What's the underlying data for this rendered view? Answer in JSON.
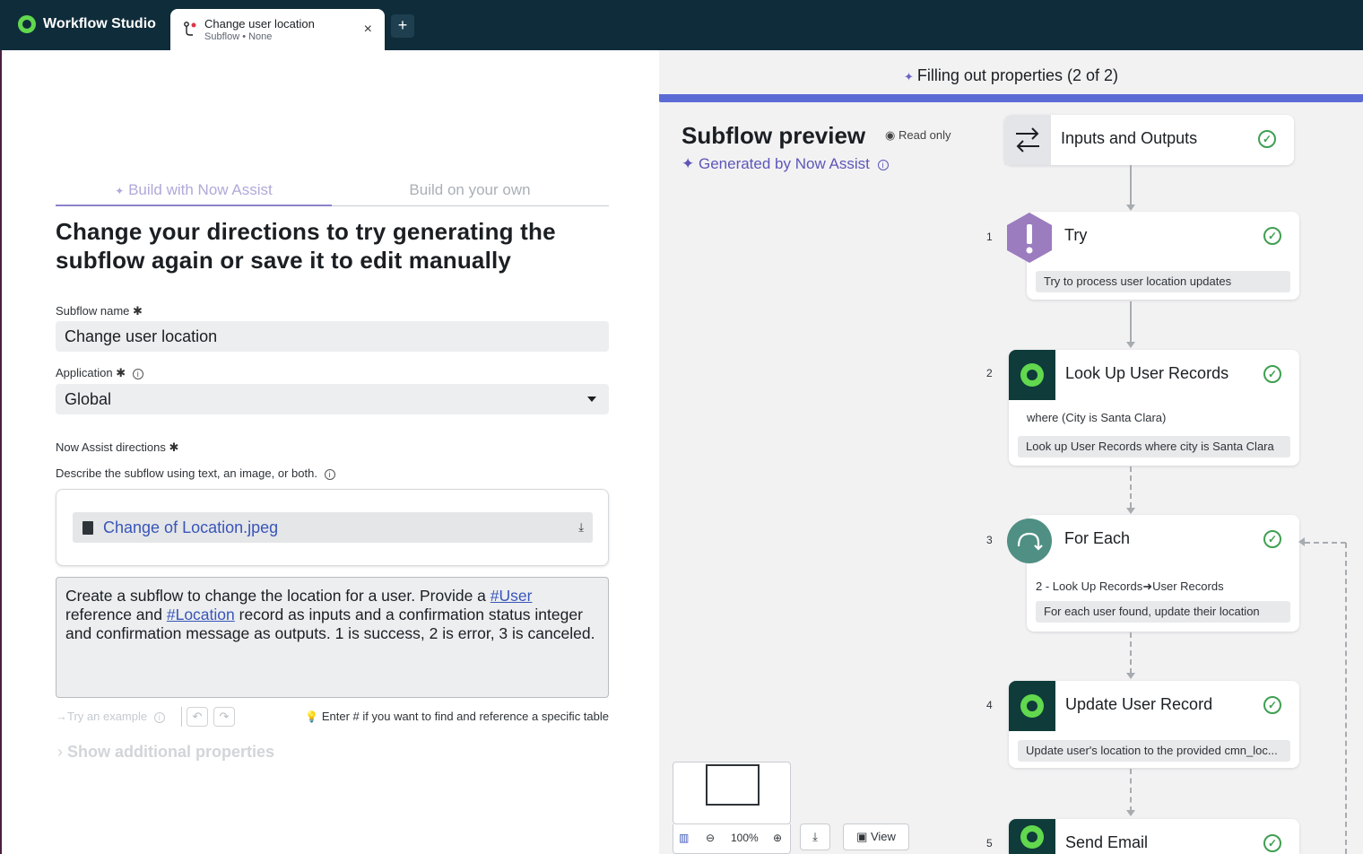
{
  "app": {
    "title": "Workflow Studio",
    "tab": {
      "title": "Change user location",
      "subtitle": "Subflow • None",
      "close": "×"
    },
    "add_tab": "+"
  },
  "left": {
    "mode_tabs": [
      "Build with Now Assist",
      "Build on your own"
    ],
    "mode_tab_spark": "✦",
    "heading_line1": "Change your directions to try generating the",
    "heading_line2": "subflow again or save it to edit manually",
    "subflow_name": {
      "label": "Subflow name",
      "required": "✱",
      "value": "Change user location"
    },
    "application": {
      "label": "Application",
      "required": "✱",
      "value": "Global"
    },
    "directions": {
      "label": "Now Assist directions",
      "required": "✱",
      "help": "Describe the subflow using text, an image, or both.",
      "attachment": "Change of Location.jpeg",
      "text_1": "Create a subflow to change the location for a user. Provide a ",
      "ref_user": "#User",
      "text_2": " reference and ",
      "ref_location": "#Location",
      "text_3": " record as inputs and a confirmation status integer and confirmation message as outputs. 1 is success, 2 is error, 3 is canceled."
    },
    "try_example": "→Try an example",
    "undo": "↶",
    "redo": "↷",
    "hint": "Enter # if you want to find and reference a specific table",
    "show_more": "Show additional properties"
  },
  "right": {
    "status": "Filling out properties (2 of 2)",
    "status_progress": 1.0,
    "title": "Subflow preview",
    "read_only": "Read only",
    "generated": "Generated by Now Assist",
    "nodes": [
      {
        "num": "",
        "title": "Inputs and Outputs",
        "icon": "arrows-swap-icon"
      },
      {
        "num": "1",
        "title": "Try",
        "icon": "exclamation-hexagon-icon",
        "pill": "Try to process user location updates"
      },
      {
        "num": "2",
        "title": "Look Up User Records",
        "icon": "servicenow-logo-icon",
        "condition": "where (City is Santa Clara)",
        "pill": "Look up User Records where city is Santa Clara"
      },
      {
        "num": "3",
        "title": "For Each",
        "icon": "loop-icon",
        "condition": "2 - Look Up Records➜User Records",
        "pill": "For each user found, update their location"
      },
      {
        "num": "4",
        "title": "Update User Record",
        "icon": "servicenow-logo-icon",
        "pill": "Update user's location to the provided cmn_loc..."
      },
      {
        "num": "5",
        "title": "Send Email",
        "icon": "servicenow-logo-icon"
      }
    ],
    "zoom": "100%",
    "view_label": "View"
  },
  "colors": {
    "topbar": "#0f2c3a",
    "accent": "#5b6bd6",
    "assist": "#5d56b8",
    "success": "#3f9f52",
    "brand_green": "#62d84e"
  }
}
